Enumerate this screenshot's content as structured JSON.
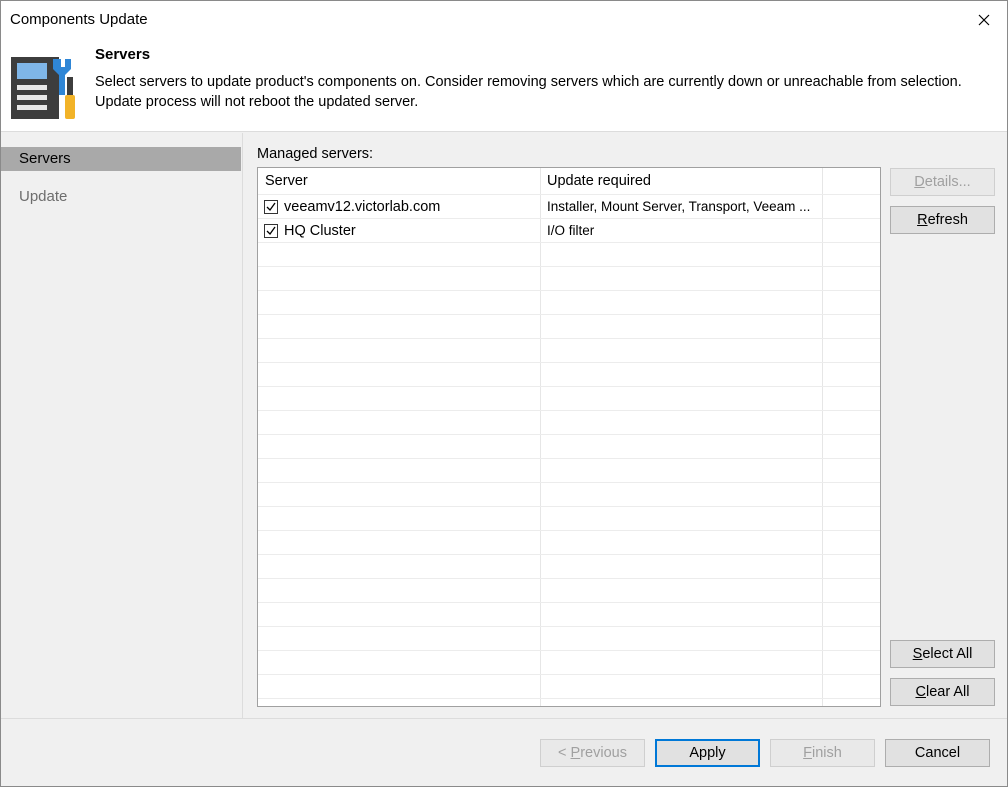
{
  "window": {
    "title": "Components Update"
  },
  "header": {
    "title": "Servers",
    "description_line1": "Select servers to update product's components on. Consider removing servers which are currently down or unreachable from selection.",
    "description_line2": "Update process will not reboot the updated server."
  },
  "sidebar": {
    "items": [
      {
        "label": "Servers",
        "active": true
      },
      {
        "label": "Update",
        "active": false
      }
    ]
  },
  "main": {
    "list_label": "Managed servers:",
    "columns": [
      "Server",
      "Update required"
    ],
    "rows": [
      {
        "server": "veeamv12.victorlab.com",
        "update": "Installer, Mount Server, Transport, Veeam ...",
        "checked": true
      },
      {
        "server": "HQ Cluster",
        "update": "I/O filter",
        "checked": true
      }
    ]
  },
  "side_buttons": {
    "details": {
      "label": "Details...",
      "mnemonic": "D",
      "rest": "etails..."
    },
    "refresh": {
      "label": "Refresh",
      "mnemonic": "R",
      "rest": "efresh"
    },
    "select_all": {
      "label": "Select All",
      "mnemonic": "S",
      "rest": "elect All"
    },
    "clear_all": {
      "label": "Clear All",
      "mnemonic": "C",
      "rest": "lear All"
    }
  },
  "footer": {
    "previous": {
      "label": "< Previous",
      "prefix": "< ",
      "mnemonic": "P",
      "rest": "revious"
    },
    "apply": {
      "label": "Apply"
    },
    "finish": {
      "label": "Finish",
      "mnemonic": "F",
      "rest": "inish"
    },
    "cancel": {
      "label": "Cancel"
    }
  },
  "colors": {
    "accent": "#0078d7",
    "selected_nav": "#a9a9a9"
  }
}
